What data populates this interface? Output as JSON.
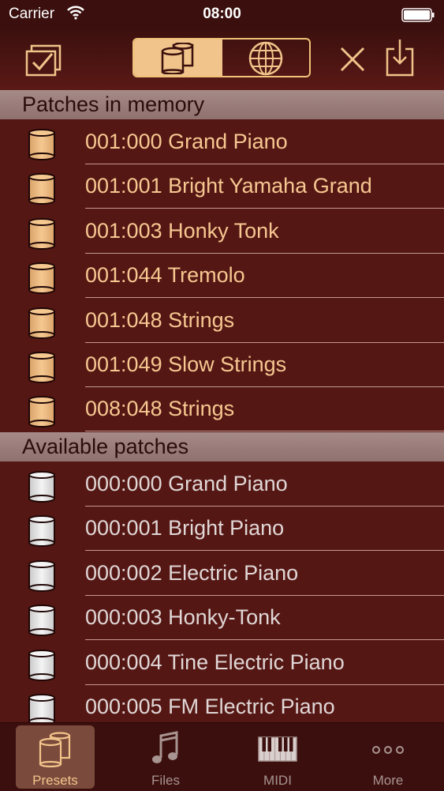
{
  "status": {
    "carrier": "Carrier",
    "time": "08:00"
  },
  "toolbar": {
    "icons": [
      "checkbox-icon",
      "cylinders-icon",
      "globe-icon",
      "close-icon",
      "download-icon"
    ]
  },
  "sections": {
    "memory": "Patches in memory",
    "available": "Available patches"
  },
  "memory_patches": [
    "001:000 Grand Piano",
    "001:001 Bright Yamaha Grand",
    "001:003 Honky Tonk",
    "001:044 Tremolo",
    "001:048 Strings",
    "001:049 Slow Strings",
    "008:048 Strings"
  ],
  "available_patches": [
    "000:000 Grand Piano",
    "000:001 Bright Piano",
    "000:002 Electric Piano",
    "000:003 Honky-Tonk",
    "000:004 Tine Electric Piano",
    "000:005 FM Electric Piano"
  ],
  "tabs": [
    {
      "label": "Presets",
      "icon": "cylinders-icon",
      "selected": true
    },
    {
      "label": "Files",
      "icon": "music-note-icon",
      "selected": false
    },
    {
      "label": "MIDI",
      "icon": "keyboard-icon",
      "selected": false
    },
    {
      "label": "More",
      "icon": "more-dots-icon",
      "selected": false
    }
  ],
  "colors": {
    "background": "#551714",
    "accent": "#f0c48a",
    "memory_text": "#f6c891",
    "available_text": "#e0d7d6"
  }
}
